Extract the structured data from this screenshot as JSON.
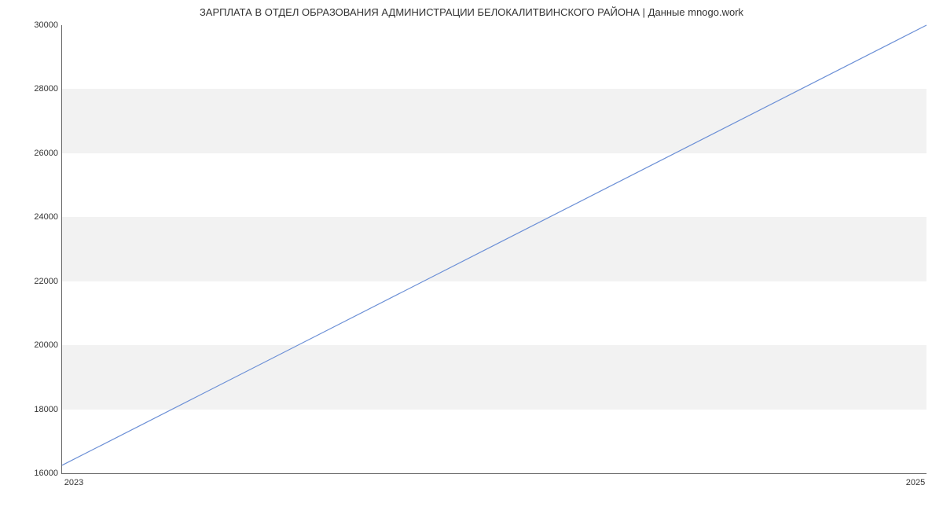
{
  "chart_data": {
    "type": "line",
    "title": "ЗАРПЛАТА В ОТДЕЛ ОБРАЗОВАНИЯ АДМИНИСТРАЦИИ БЕЛОКАЛИТВИНСКОГО РАЙОНА | Данные mnogo.work",
    "x": [
      2023,
      2025
    ],
    "values": [
      16250,
      30000
    ],
    "xlabel": "",
    "ylabel": "",
    "x_ticks": [
      "2023",
      "2025"
    ],
    "y_ticks": [
      "16000",
      "18000",
      "20000",
      "22000",
      "24000",
      "26000",
      "28000",
      "30000"
    ],
    "ylim": [
      16000,
      30000
    ],
    "xlim": [
      2023,
      2025
    ],
    "grid": true
  }
}
